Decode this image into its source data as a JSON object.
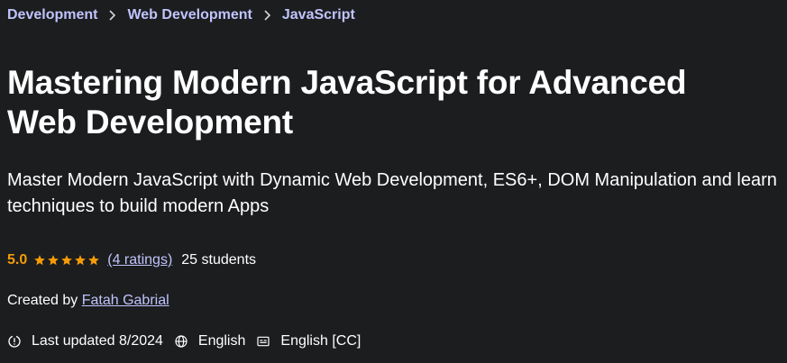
{
  "breadcrumb": {
    "items": [
      "Development",
      "Web Development",
      "JavaScript"
    ],
    "separator_icon": "chevron-right-icon"
  },
  "course": {
    "title": "Mastering Modern JavaScript for Advanced Web Development",
    "subtitle": "Master Modern JavaScript with Dynamic Web Development, ES6+, DOM Manipulation and learn techniques to build modern Apps"
  },
  "rating": {
    "score": "5.0",
    "stars": 5,
    "max_stars": 5,
    "ratings_link": "(4 ratings)",
    "students": "25 students"
  },
  "creator": {
    "prefix": "Created by",
    "name": "Fatah Gabrial"
  },
  "meta": {
    "last_updated": "Last updated 8/2024",
    "language": "English",
    "captions": "English [CC]"
  },
  "colors": {
    "background": "#1c1d1f",
    "link": "#c0c4fc",
    "rating": "#f69c08",
    "text": "#ffffff"
  }
}
